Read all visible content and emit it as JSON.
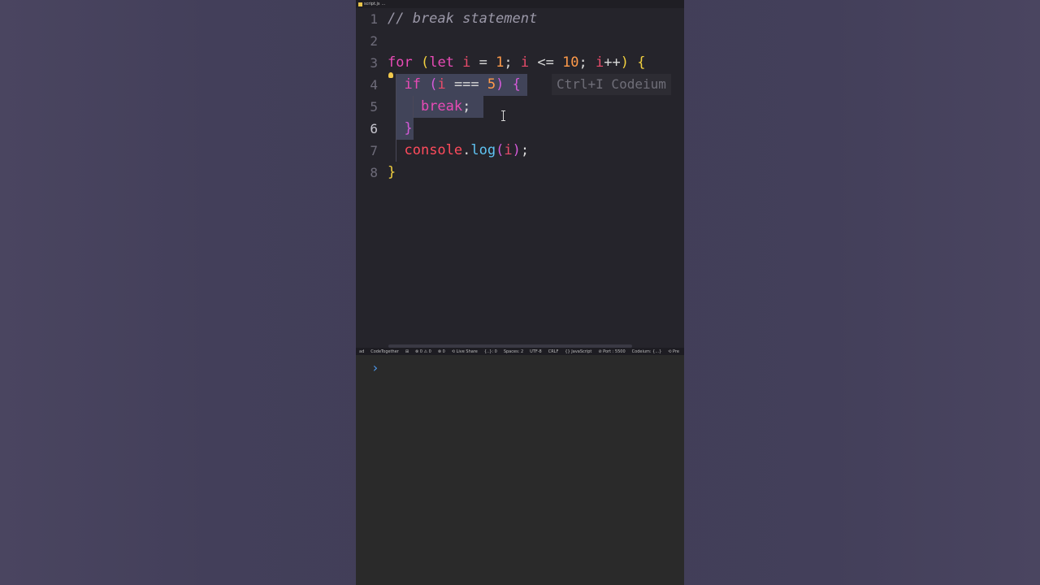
{
  "tab": {
    "filename": "script.js",
    "extra": "..."
  },
  "editor": {
    "lines": [
      {
        "num": "1",
        "tokens": [
          [
            "cm",
            "// break statement"
          ]
        ]
      },
      {
        "num": "2",
        "tokens": []
      },
      {
        "num": "3",
        "tokens": [
          [
            "kw",
            "for "
          ],
          [
            "pn",
            "("
          ],
          [
            "kw",
            "let "
          ],
          [
            "vr",
            "i "
          ],
          [
            "op",
            "= "
          ],
          [
            "nm",
            "1"
          ],
          [
            "op",
            "; "
          ],
          [
            "vr",
            "i "
          ],
          [
            "op",
            "<= "
          ],
          [
            "nm",
            "10"
          ],
          [
            "op",
            "; "
          ],
          [
            "vr",
            "i"
          ],
          [
            "op",
            "++"
          ],
          [
            "pn",
            ") {"
          ]
        ]
      },
      {
        "num": "4",
        "tokens": [
          [
            "op",
            "  "
          ],
          [
            "kw",
            "if "
          ],
          [
            "pk",
            "("
          ],
          [
            "vr",
            "i "
          ],
          [
            "op",
            "=== "
          ],
          [
            "nm",
            "5"
          ],
          [
            "pk",
            ") {"
          ]
        ]
      },
      {
        "num": "5",
        "tokens": [
          [
            "op",
            "    "
          ],
          [
            "kw",
            "break"
          ],
          [
            "op",
            ";"
          ]
        ]
      },
      {
        "num": "6",
        "tokens": [
          [
            "op",
            "  "
          ],
          [
            "pk",
            "}"
          ]
        ]
      },
      {
        "num": "7",
        "tokens": [
          [
            "op",
            "  "
          ],
          [
            "obj",
            "console"
          ],
          [
            "op",
            "."
          ],
          [
            "fn",
            "log"
          ],
          [
            "pk",
            "("
          ],
          [
            "vr",
            "i"
          ],
          [
            "pk",
            ")"
          ],
          [
            "op",
            ";"
          ]
        ]
      },
      {
        "num": "8",
        "tokens": [
          [
            "pn",
            "}"
          ]
        ]
      }
    ],
    "active_line": "6",
    "inline_hint": "Ctrl+I Codeium"
  },
  "statusbar": {
    "items": [
      "ad",
      "CodeTogether",
      "⊞",
      "⊗ 0 ⚠ 0",
      "⊗ 0",
      "⟲ Live Share",
      "{..}: 0",
      "Spaces: 2",
      "UTF-8",
      "CRLF",
      "{} JavaScript",
      "⊘ Port : 5500",
      "Codeium: {...}",
      "⟲ Pre"
    ]
  },
  "terminal": {
    "prompt": "›"
  },
  "colors": {
    "editor_bg": "#25242b",
    "selection": "#414459",
    "terminal_bg": "#2a2a2a"
  }
}
